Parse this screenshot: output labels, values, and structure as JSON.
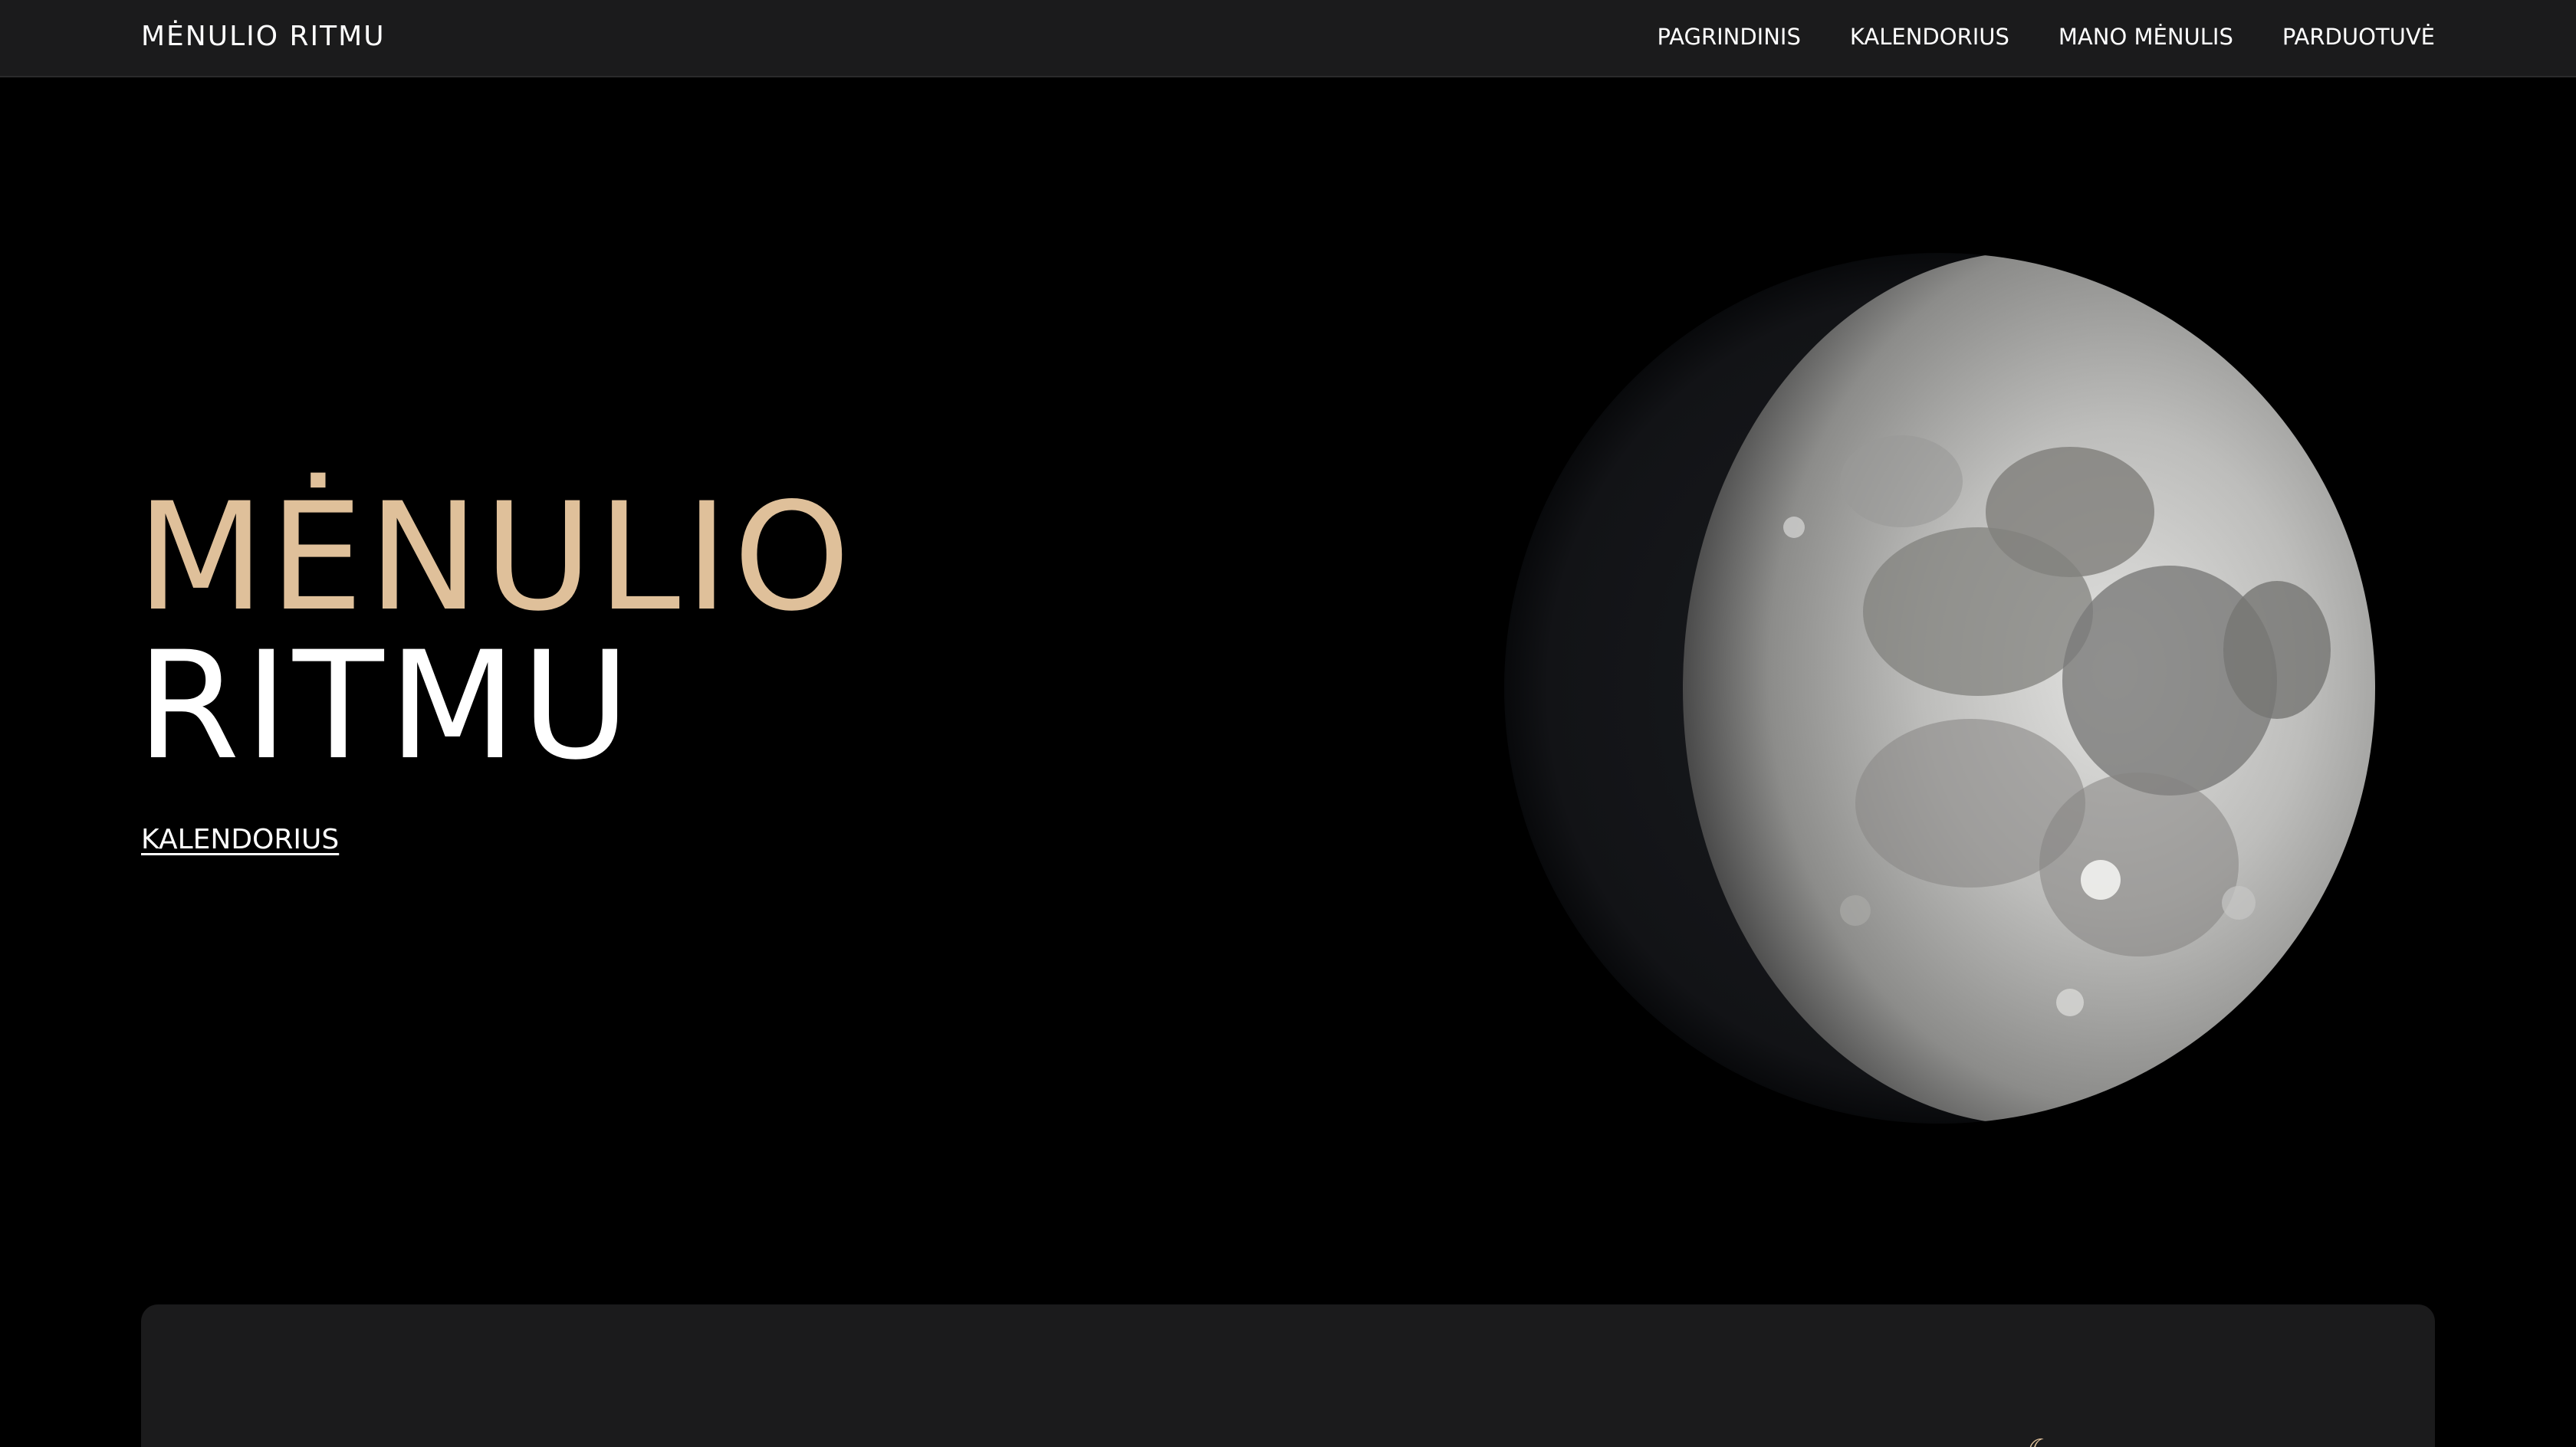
{
  "header": {
    "brand": "MĖNULIO RITMU",
    "nav": [
      {
        "label": "PAGRINDINIS"
      },
      {
        "label": "KALENDORIUS"
      },
      {
        "label": "MANO MĖNULIS"
      },
      {
        "label": "PARDUOTUVĖ"
      }
    ]
  },
  "hero": {
    "title_line1": "MĖNULIO",
    "title_line2": "RITMU",
    "cta_label": "KALENDORIUS"
  },
  "colors": {
    "background": "#000000",
    "navbar": "#1b1b1c",
    "accent_gold": "#dfc09a",
    "card": "#1b1b1c"
  },
  "icons": [
    "moon-image",
    "sparkle-icon",
    "crescent-icon"
  ]
}
